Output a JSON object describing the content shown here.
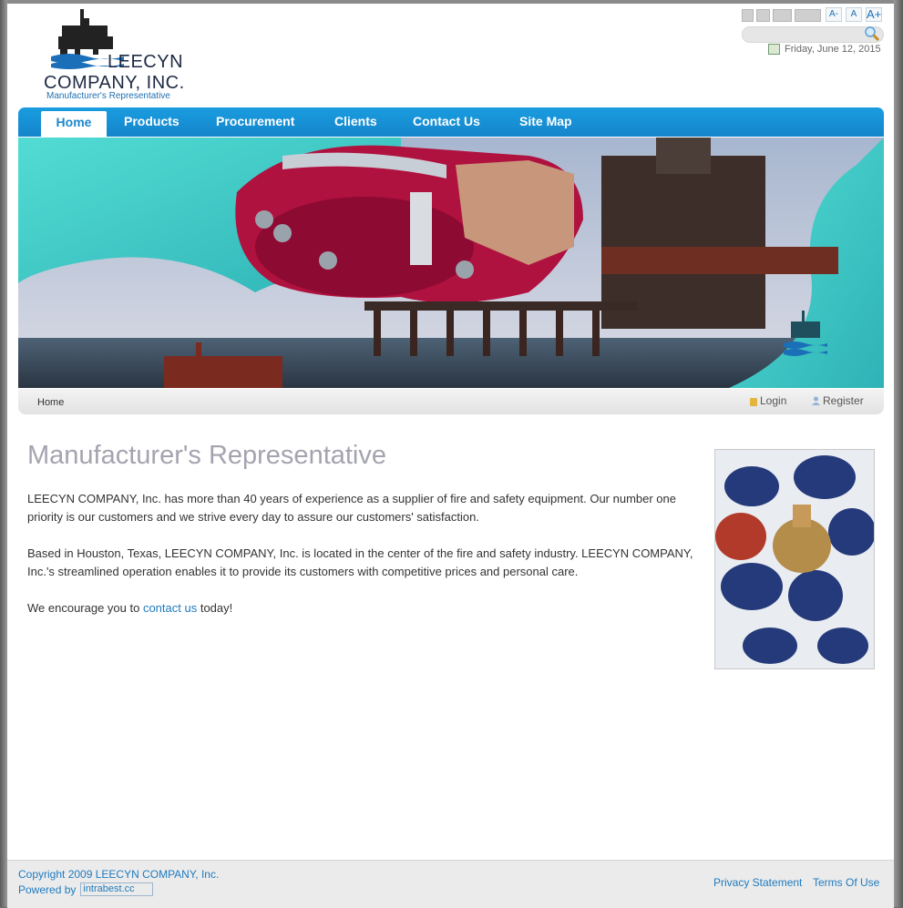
{
  "logo": {
    "line1": "LEECYN",
    "line2": "COMPANY, INC.",
    "tagline": "Manufacturer's Representative"
  },
  "header": {
    "font_size_buttons": [
      "A-",
      "A",
      "A+"
    ],
    "date": "Friday, June 12, 2015"
  },
  "nav": {
    "items": [
      {
        "label": "Home"
      },
      {
        "label": "Products"
      },
      {
        "label": "Procurement"
      },
      {
        "label": "Clients"
      },
      {
        "label": "Contact Us"
      },
      {
        "label": "Site Map"
      }
    ]
  },
  "breadcrumb": {
    "current": "Home",
    "login_label": "Login",
    "register_label": "Register"
  },
  "main": {
    "heading": "Manufacturer's Representative",
    "para1": "LEECYN COMPANY, Inc. has more than 40 years of experience as a supplier of fire and safety equipment. Our number one priority is our customers and we strive every day to assure our customers' satisfaction.",
    "para2": "Based in Houston, Texas, LEECYN COMPANY, Inc. is located in the center of the fire and safety industry. LEECYN COMPANY, Inc.'s streamlined operation enables it to provide its customers with competitive prices and personal care.",
    "para3_before": "We encourage you to ",
    "para3_link": "contact us",
    "para3_after": " today!"
  },
  "footer": {
    "copyright": "Copyright 2009 LEECYN COMPANY, Inc.",
    "powered_by": "Powered by",
    "badge_alt": "intrabest.cc",
    "privacy": "Privacy Statement",
    "terms": "Terms Of Use"
  },
  "colors": {
    "nav_blue": "#1a9de0",
    "link_blue": "#1f7bbf",
    "heading_gray": "#a4a4b0"
  }
}
